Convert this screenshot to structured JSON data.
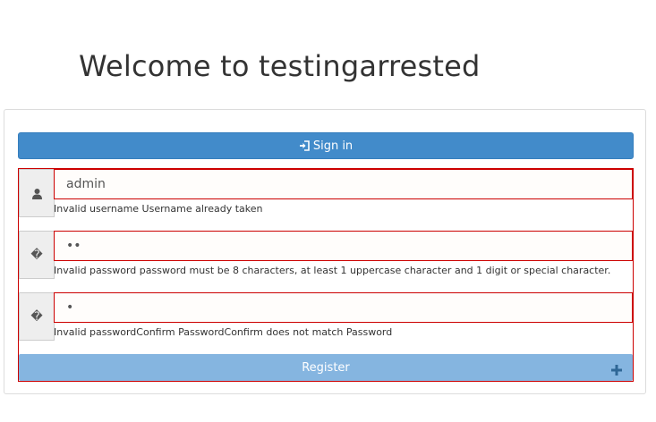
{
  "page": {
    "title": "Welcome to testingarrested"
  },
  "signin": {
    "label": "Sign in",
    "icon": "sign-in-icon"
  },
  "form": {
    "username": {
      "icon": "user-icon",
      "icon_glyph": "",
      "value": "admin",
      "error": "Invalid username Username already taken"
    },
    "password": {
      "icon": "lock-icon",
      "icon_glyph": "�",
      "value": "••",
      "error": "Invalid password password must be 8 characters, at least 1 uppercase character and 1 digit or special character."
    },
    "password_confirm": {
      "icon": "lock-icon",
      "icon_glyph": "�",
      "value": "•",
      "error": "Invalid passwordConfirm PasswordConfirm does not match Password"
    },
    "register": {
      "label": "Register",
      "icon": "plus-icon"
    }
  },
  "colors": {
    "primary": "#428bca",
    "register": "#85b5e0",
    "error_border": "#cc0000",
    "addon_bg": "#eeeeee"
  }
}
